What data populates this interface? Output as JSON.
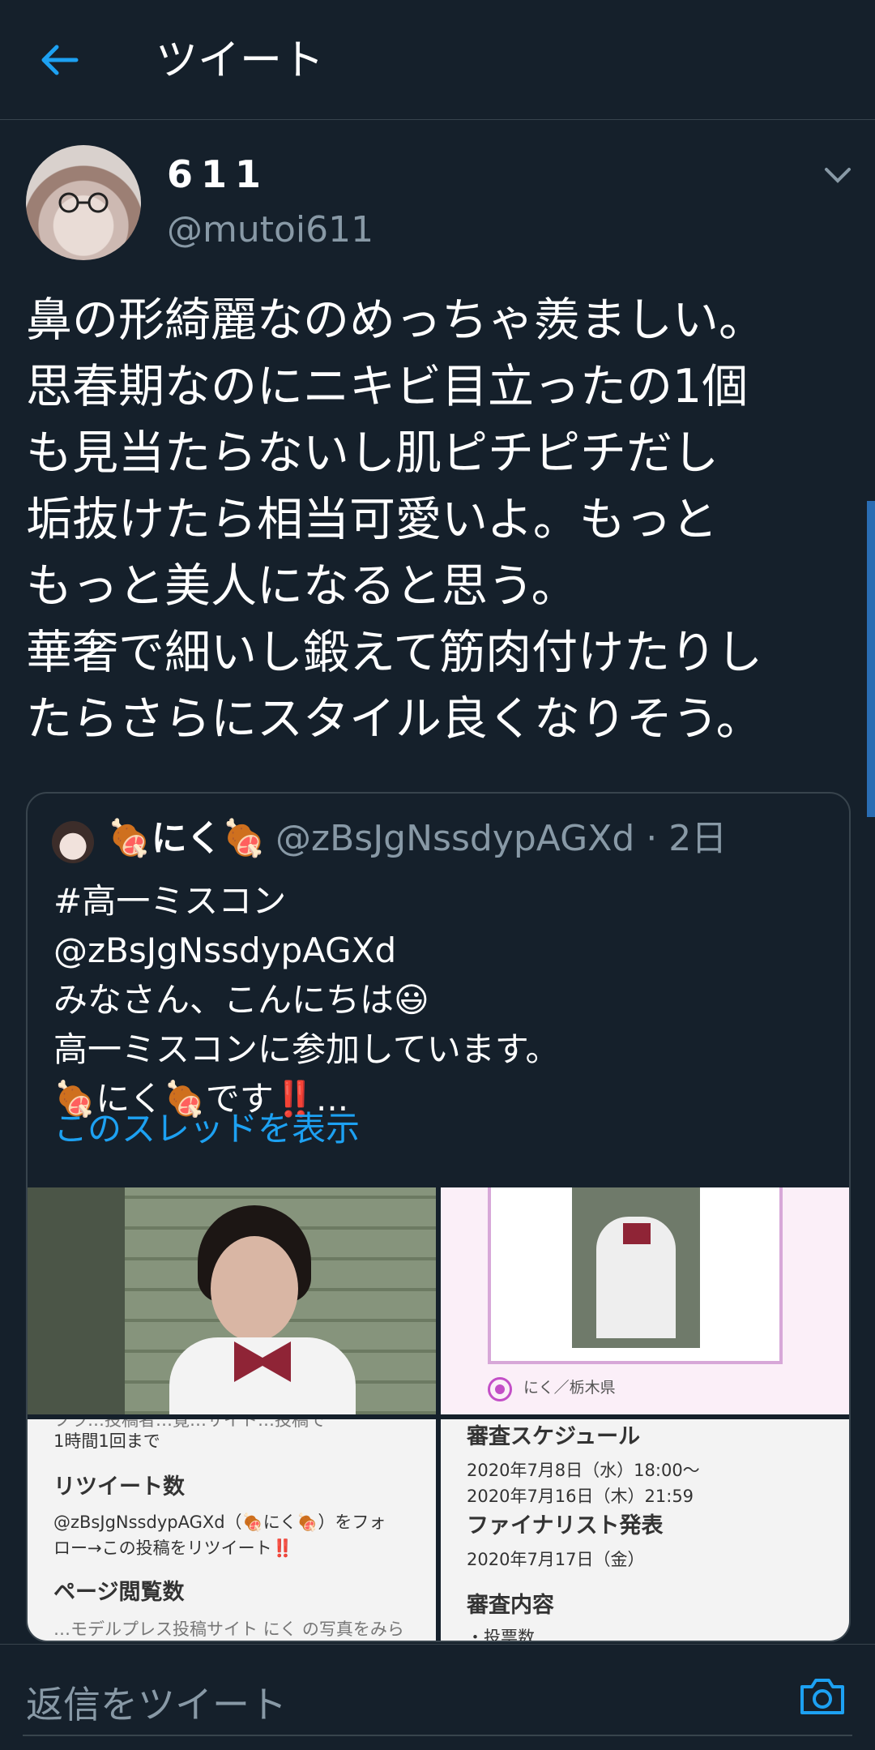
{
  "header": {
    "title": "ツイート",
    "back_icon": "arrow-left-icon"
  },
  "tweet": {
    "author_name": "611",
    "author_handle": "@mutoi611",
    "text": "鼻の形綺麗なのめっちゃ羨ましい。\n思春期なのにニキビ目立ったの1個\nも見当たらないし肌ピチピチだし\n垢抜けたら相当可愛いよ。もっと\nもっと美人になると思う。\n華奢で細いし鍛えて筋肉付けたりし\nたらさらにスタイル良くなりそう。"
  },
  "quote": {
    "author_name": "🍖にく🍖",
    "author_handle": "@zBsJgNssdypAGXd · 2日",
    "text": "#高一ミスコン\n@zBsJgNssdypAGXd\nみなさん、こんにちは😃\n高一ミスコンに参加しています。\n🍖にく🍖です‼️...",
    "show_thread": "このスレッドを表示",
    "image2_caption": "にく／栃木県",
    "image3": {
      "top_cut": "フラ…投稿者…覧…サイト…投稿で",
      "line1": "1時間1回まで",
      "heading1": "リツイート数",
      "line2": "@zBsJgNssdypAGXd（🍖にく🍖）をフォ",
      "line3": "ロー→この投稿をリツイート‼️",
      "heading2": "ページ閲覧数",
      "bottom_cut": "…モデルプレス投稿サイト にく の写真をみら"
    },
    "image4": {
      "heading1": "審査スケジュール",
      "line1": "2020年7月8日（水）18:00〜",
      "line2": "2020年7月16日（木）21:59",
      "heading2": "ファイナリスト発表",
      "line3": "2020年7月17日（金）",
      "heading3": "審査内容",
      "bottom_cut": "・投票数"
    }
  },
  "reply": {
    "placeholder": "返信をツイート",
    "camera_icon": "camera-icon"
  },
  "colors": {
    "background": "#15202b",
    "accent": "#1da1f2",
    "secondary_text": "#8899a6",
    "border": "#38444d"
  }
}
